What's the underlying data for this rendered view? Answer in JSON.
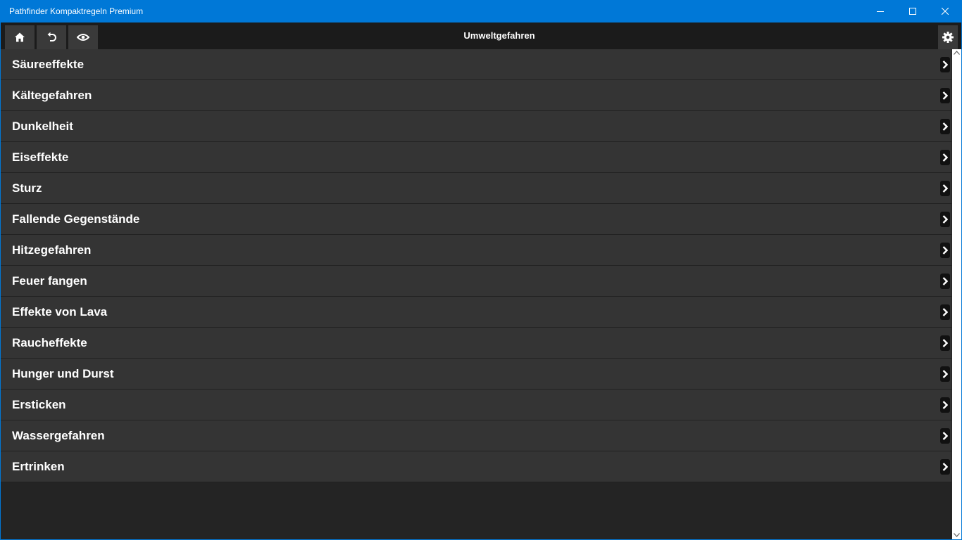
{
  "window": {
    "title": "Pathfinder Kompaktregeln Premium",
    "accent": "#0078d7"
  },
  "toolbar": {
    "title": "Umweltgefahren",
    "buttons": [
      "home-icon",
      "undo-icon",
      "eye-icon"
    ],
    "settings_icon": "gear-icon"
  },
  "list": {
    "items": [
      {
        "label": "Säureeffekte"
      },
      {
        "label": "Kältegefahren"
      },
      {
        "label": "Dunkelheit"
      },
      {
        "label": "Eiseffekte"
      },
      {
        "label": "Sturz"
      },
      {
        "label": "Fallende Gegenstände"
      },
      {
        "label": "Hitzegefahren"
      },
      {
        "label": "Feuer fangen"
      },
      {
        "label": "Effekte von Lava"
      },
      {
        "label": "Raucheffekte"
      },
      {
        "label": "Hunger und Durst"
      },
      {
        "label": "Ersticken"
      },
      {
        "label": "Wassergefahren"
      },
      {
        "label": "Ertrinken"
      }
    ]
  }
}
